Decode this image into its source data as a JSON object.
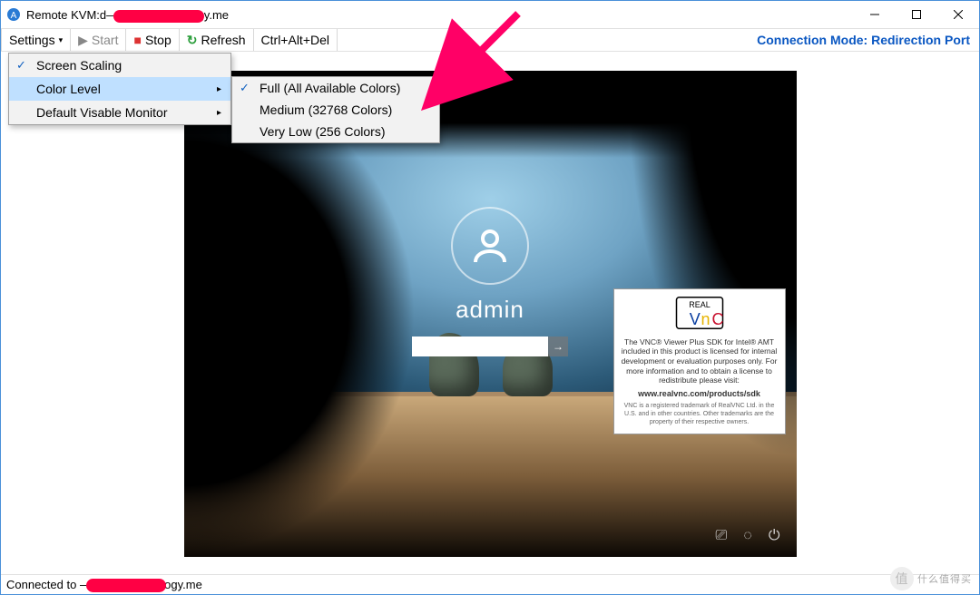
{
  "title": "Remote KVM:d————e.synology.me",
  "toolbar": {
    "settings": "Settings",
    "start": "Start",
    "stop": "Stop",
    "refresh": "Refresh",
    "cad": "Ctrl+Alt+Del",
    "conn_mode": "Connection Mode: Redirection Port"
  },
  "settings_menu": {
    "screen_scaling": "Screen Scaling",
    "color_level": "Color Level",
    "default_monitor": "Default Visable Monitor"
  },
  "color_submenu": {
    "full": "Full (All Available Colors)",
    "medium": "Medium (32768 Colors)",
    "verylow": "Very Low (256 Colors)"
  },
  "login": {
    "username": "admin",
    "pw_placeholder": ""
  },
  "vnc": {
    "text": "The VNC® Viewer Plus SDK for Intel® AMT included in this product is licensed for internal development or evaluation purposes only.  For more information and to obtain a license to redistribute please visit:",
    "url": "www.realvnc.com/products/sdk",
    "small": "VNC is a registered trademark of RealVNC Ltd. in the U.S. and in other countries. Other trademarks are the property of their respective owners."
  },
  "statusbar": "Connected to ————e.synology.me",
  "watermark": "什么值得买"
}
